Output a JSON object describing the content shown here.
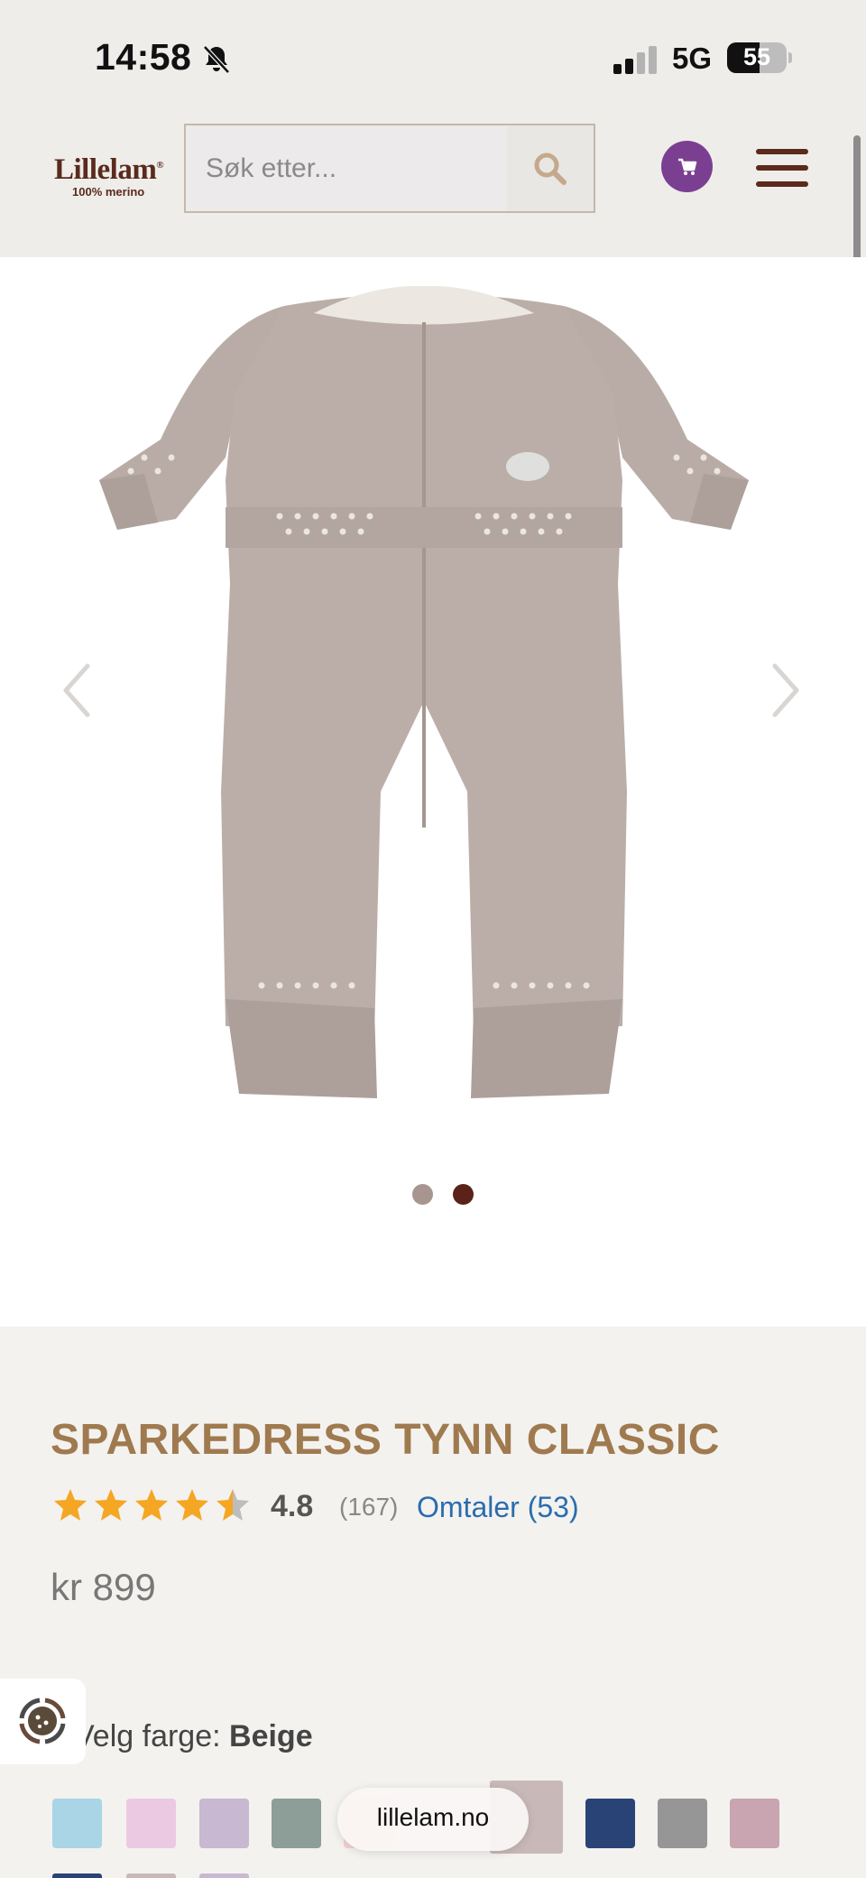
{
  "status_bar": {
    "time": "14:58",
    "network": "5G",
    "battery_percent": "55",
    "battery_level": 0.55,
    "muted": true
  },
  "header": {
    "logo_name": "Lillelam",
    "logo_sub": "100% merino",
    "search_placeholder": "Søk etter...",
    "cart_color": "#7b3f92",
    "accent": "#5a2a1c"
  },
  "gallery": {
    "slides": 2,
    "active_slide": 2,
    "dot_inactive_color": "#a89590",
    "dot_active_color": "#5a2218",
    "product_color": "#b8aba5"
  },
  "product": {
    "title": "SPARKEDRESS TYNN CLASSIC",
    "rating": "4.8",
    "rating_stars": 4.5,
    "rating_count": "(167)",
    "reviews_link": "Omtaler (53)",
    "price": "kr 899"
  },
  "color_selector": {
    "prefix": "Velg farge: ",
    "selected": "Beige",
    "swatches": [
      {
        "name": "light-blue",
        "color": "#a9d5e6"
      },
      {
        "name": "pink",
        "color": "#ecc9e2"
      },
      {
        "name": "lavender",
        "color": "#c9b8d1"
      },
      {
        "name": "sage",
        "color": "#8c9e97"
      },
      {
        "name": "rose",
        "color": "#f2d2d0"
      },
      {
        "name": "beige",
        "color": "#c8b9b8"
      },
      {
        "name": "navy",
        "color": "#2a4377"
      },
      {
        "name": "grey",
        "color": "#969696"
      },
      {
        "name": "mauve",
        "color": "#c9a4b1"
      }
    ]
  },
  "browser": {
    "domain": "lillelam.no"
  }
}
